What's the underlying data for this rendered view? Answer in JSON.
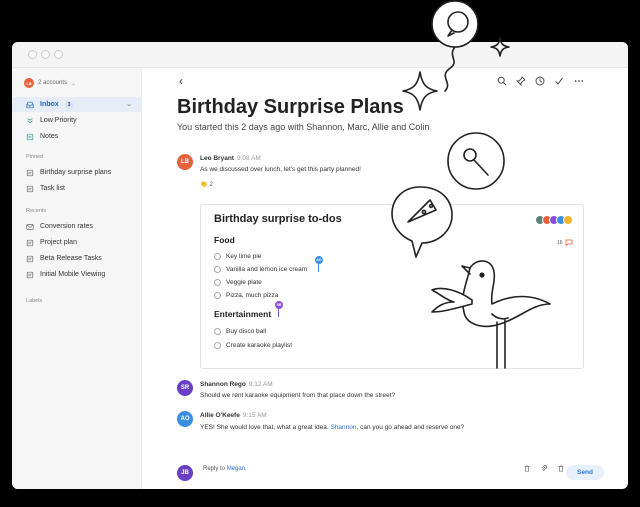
{
  "sidebar": {
    "account_initials": "LB",
    "account_label": "2 accounts",
    "items": [
      {
        "label": "Inbox",
        "badge": "3",
        "icon": "inbox-icon"
      },
      {
        "label": "Low Priority",
        "icon": "low-priority-icon"
      },
      {
        "label": "Notes",
        "icon": "notes-icon"
      }
    ],
    "pinned_label": "Pinned",
    "pinned": [
      {
        "label": "Birthday surprise plans",
        "icon": "note-icon"
      },
      {
        "label": "Task list",
        "icon": "note-icon"
      }
    ],
    "recents_label": "Recents",
    "recents": [
      {
        "label": "Conversion rates",
        "icon": "mail-icon"
      },
      {
        "label": "Project plan",
        "icon": "note-icon"
      },
      {
        "label": "Beta Release Tasks",
        "icon": "note-icon"
      },
      {
        "label": "Initial Mobile Viewing",
        "icon": "note-icon"
      }
    ],
    "labels_label": "Labels"
  },
  "thread": {
    "title": "Birthday Surprise Plans",
    "subtitle": "You started this 2 days ago with Shannon, Marc, Allie and Colin",
    "messages": [
      {
        "initials": "LB",
        "name": "Leo Bryant",
        "time": "9:08 AM",
        "text": "As we discussed over lunch, let's get this party planned!",
        "color": "#e8623c"
      },
      {
        "initials": "SR",
        "name": "Shannon Rego",
        "time": "9:12 AM",
        "text": "Should we rent karaoke equipment from that place down the street?",
        "color": "#6a3fc4"
      },
      {
        "initials": "AO",
        "name": "Allie O'Keefe",
        "time": "9:15 AM",
        "text_before": "YES! She would love that, what a great idea. ",
        "mention": "Shannon",
        "text_after": ", can you go ahead and reserve one?",
        "color": "#3c8fe0"
      }
    ],
    "reaction": {
      "emoji": "👏",
      "count": "2"
    }
  },
  "card": {
    "title": "Birthday surprise to-dos",
    "comment_count": "16",
    "food_heading": "Food",
    "food": [
      "Key lime pie",
      "Vanilla and lemon ice cream",
      "Veggie plate",
      "Pizza, much pizza"
    ],
    "ent_heading": "Entertainment",
    "entertainment": [
      "Buy disco ball",
      "Create karaoke playlist"
    ],
    "cursor_ao": "AO",
    "cursor_sr": "SR"
  },
  "reply": {
    "initials": "JB",
    "prefix": "Reply to ",
    "target": "Megan,",
    "send_label": "Send"
  },
  "colors": {
    "accent": "#2a73d9",
    "active_bg": "#e7edf6"
  }
}
